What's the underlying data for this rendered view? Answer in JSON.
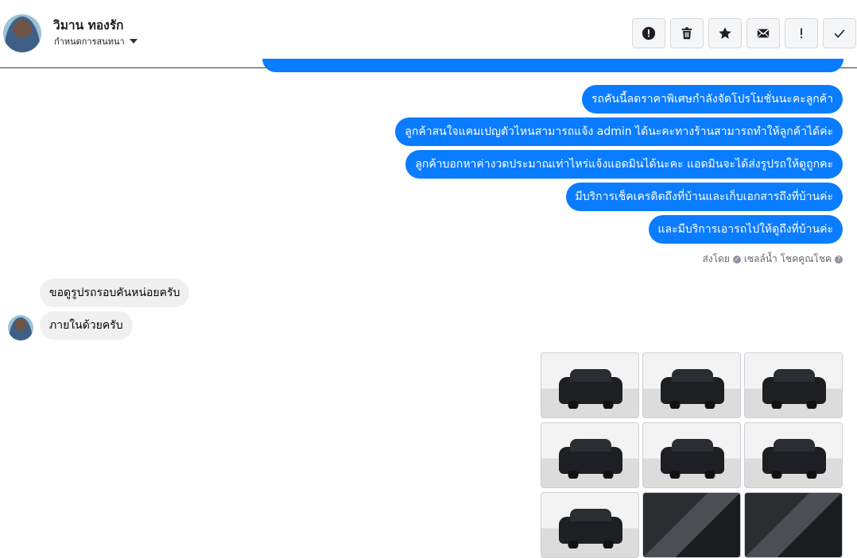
{
  "header": {
    "name": "วิมาน ทองรัก",
    "subtitle": "กำหนดการสนทนา",
    "actions": [
      {
        "icon": "alert-circle-icon"
      },
      {
        "icon": "trash-icon"
      },
      {
        "icon": "star-icon"
      },
      {
        "icon": "envelope-icon"
      },
      {
        "icon": "exclamation-icon"
      },
      {
        "icon": "checkmark-icon"
      }
    ]
  },
  "outgoing": [
    "รถคันนี้ลดราคาพิเศษกำลังจัดโปรโมชั่นนะคะลูกค้า",
    "ลูกค้าสนใจแคมเปญตัวไหนสามารถแจ้ง admin ได้นะคะทางร้านสามารถทำให้ลูกค้าได้ค่ะ",
    "ลูกค้าบอกหาค่างวดประมาณเท่าไหร่แจ้งแอดมินได้นะคะ แอดมินจะได้ส่งรูปรถให้ดูถูกคะ",
    "มีบริการเช็คเครดิตถึงที่บ้านและเก็บเอกสารถึงที่บ้านค่ะ",
    "และมีบริการเอารถไปให้ดูถึงที่บ้านค่ะ"
  ],
  "sent_by": {
    "prefix": "ส่งโดย",
    "agent": "เซลล์น้ำ โชคคูณโชค",
    "help": "?"
  },
  "incoming": [
    "ขอดูรูปรถรอบคันหน่อยครับ",
    "ภายในด้วยครับ"
  ],
  "colors": {
    "outgoing_bubble": "#0a7cff",
    "incoming_bubble": "#f0f0f0"
  }
}
